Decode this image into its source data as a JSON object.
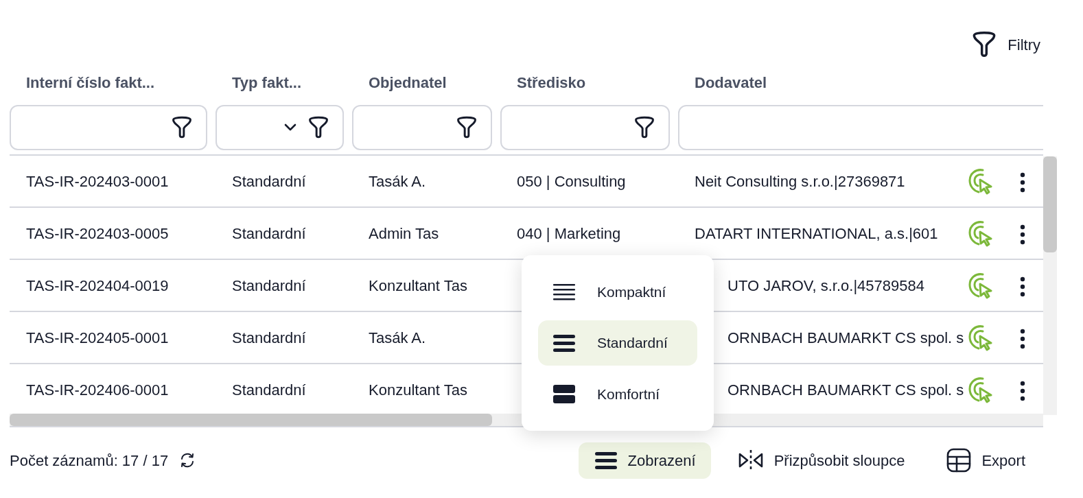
{
  "toolbar": {
    "filters_button": "Filtry"
  },
  "table": {
    "columns": [
      {
        "label": "Interní číslo fakt...",
        "kind": "text"
      },
      {
        "label": "Typ fakt...",
        "kind": "select"
      },
      {
        "label": "Objednatel",
        "kind": "text"
      },
      {
        "label": "Středisko",
        "kind": "text"
      },
      {
        "label": "Dodavatel",
        "kind": "text"
      }
    ],
    "rows": [
      {
        "number": "TAS-IR-202403-0001",
        "type": "Standardní",
        "orderer": "Tasák A.",
        "center": "050 | Consulting",
        "supplier": "Neit Consulting s.r.o.|27369871"
      },
      {
        "number": "TAS-IR-202403-0005",
        "type": "Standardní",
        "orderer": "Admin Tas",
        "center": "040 | Marketing",
        "supplier": "DATART INTERNATIONAL, a.s.|601"
      },
      {
        "number": "TAS-IR-202404-0019",
        "type": "Standardní",
        "orderer": "Konzultant Tas",
        "supplier": "UTO JAROV, s.r.o.|45789584"
      },
      {
        "number": "TAS-IR-202405-0001",
        "type": "Standardní",
        "orderer": "Tasák A.",
        "supplier": "ORNBACH BAUMARKT CS spol. s"
      },
      {
        "number": "TAS-IR-202406-0001",
        "type": "Standardní",
        "orderer": "Konzultant Tas",
        "supplier": "ORNBACH BAUMARKT CS spol. s"
      }
    ]
  },
  "density_menu": [
    {
      "label": "Kompaktní",
      "kind": "compact",
      "selected": false
    },
    {
      "label": "Standardní",
      "kind": "standard",
      "selected": true
    },
    {
      "label": "Komfortní",
      "kind": "comfort",
      "selected": false
    }
  ],
  "footer": {
    "record_count": "Počet záznamů: 17 / 17",
    "buttons": [
      {
        "label": "Zobrazení",
        "kind": "view",
        "selected": true
      },
      {
        "label": "Přizpůsobit sloupce",
        "kind": "fit",
        "selected": false
      },
      {
        "label": "Export",
        "kind": "export",
        "selected": false
      }
    ]
  }
}
